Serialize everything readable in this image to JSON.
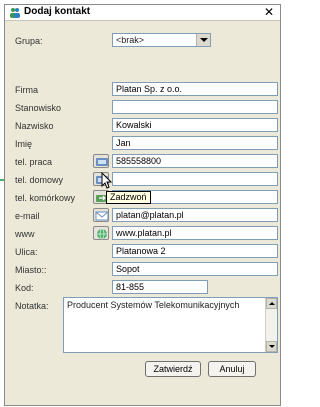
{
  "window": {
    "title": "Dodaj kontakt",
    "close_glyph": "✕"
  },
  "group": {
    "label": "Grupa:",
    "value": "<brak>"
  },
  "fields": {
    "firma": {
      "label": "Firma",
      "value": "Platan Sp. z o.o."
    },
    "stanowisko": {
      "label": "Stanowisko",
      "value": ""
    },
    "nazwisko": {
      "label": "Nazwisko",
      "value": "Kowalski"
    },
    "imie": {
      "label": "Imię",
      "value": "Jan"
    },
    "tel_praca": {
      "label": "tel. praca",
      "value": "585558800"
    },
    "tel_domowy": {
      "label": "tel. domowy",
      "value": ""
    },
    "tel_komorkowy": {
      "label": "tel. komórkowy",
      "value": ""
    },
    "email": {
      "label": "e-mail",
      "value": "platan@platan.pl"
    },
    "www": {
      "label": "www",
      "value": "www.platan.pl"
    },
    "ulica": {
      "label": "Ulica:",
      "value": "Platanowa 2"
    },
    "miasto": {
      "label": "Miasto::",
      "value": "Sopot"
    },
    "kod": {
      "label": "Kod:",
      "value": "81-855"
    }
  },
  "notes": {
    "label": "Notatka:",
    "value": "Producent Systemów Telekomunikacyjnych"
  },
  "tooltip": "Zadzwoń",
  "buttons": {
    "confirm": "Zatwierdź",
    "cancel": "Anuluj"
  },
  "icons": {
    "title": "contacts-icon",
    "call_work": "phone-call-icon",
    "call_home": "phone-call-icon",
    "call_mobile": "phone-call-icon",
    "email": "envelope-icon",
    "www": "globe-icon"
  },
  "colors": {
    "accent_green": "#4caf6a",
    "field_border": "#7f9db9",
    "tooltip_bg": "#ffffe1"
  }
}
